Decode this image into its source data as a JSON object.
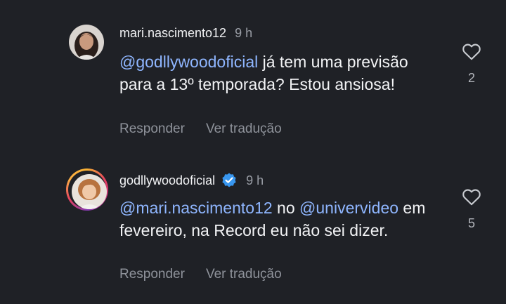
{
  "comments": [
    {
      "username": "mari.nascimento12",
      "time": "9 h",
      "verified": false,
      "mention": "@godllywoodoficial",
      "text": " já tem uma previsão para a 13º temporada? Estou ansiosa!",
      "reply_label": "Responder",
      "translate_label": "Ver tradução",
      "likes": "2"
    },
    {
      "username": "godllywoodoficial",
      "time": "9 h",
      "verified": true,
      "mention": "@mari.nascimento12",
      "text_mid": " no ",
      "mention2": "@univervideo",
      "text": " em fevereiro, na Record eu não sei dizer.",
      "reply_label": "Responder",
      "translate_label": "Ver tradução",
      "likes": "5"
    }
  ],
  "colors": {
    "background": "#1f2126",
    "mention": "#8fb6ff",
    "verified": "#3897f0",
    "muted": "#8f939b"
  }
}
